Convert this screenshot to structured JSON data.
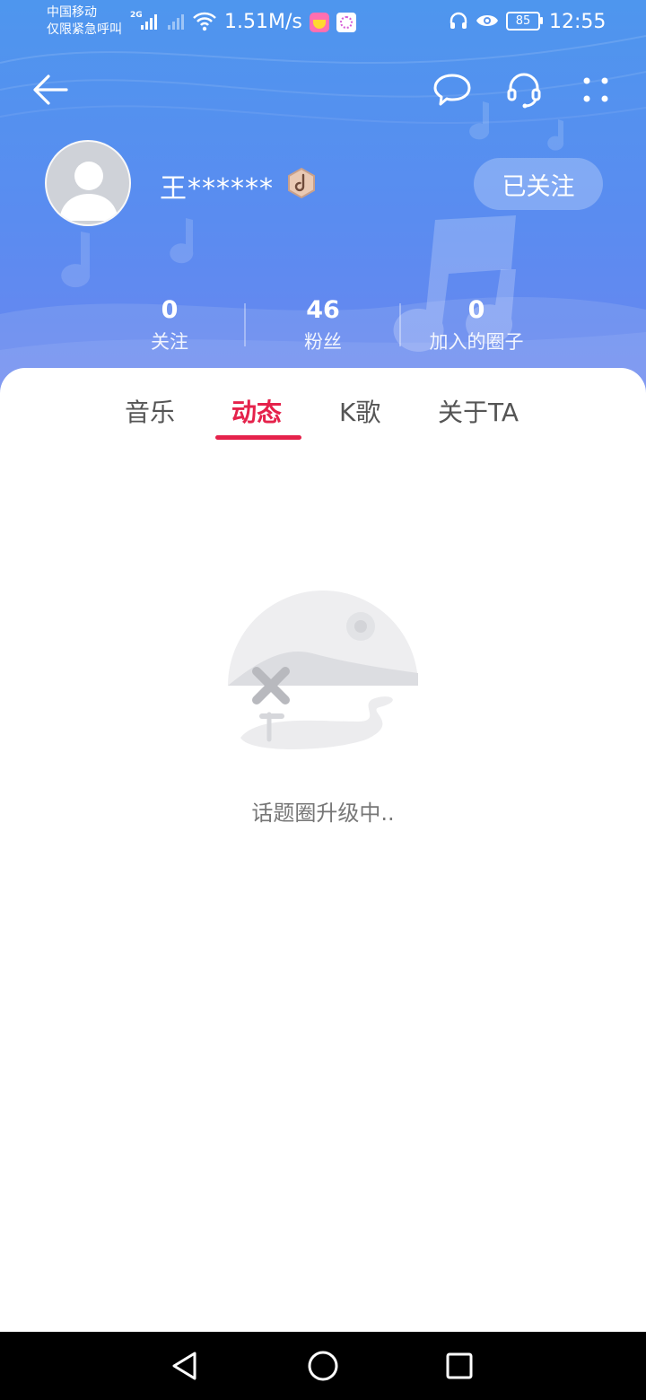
{
  "status_bar": {
    "carrier_line1": "中国移动",
    "carrier_line2": "仅限紧急呼叫",
    "network_type": "2G",
    "speed": "1.51M/s",
    "battery": "85",
    "time": "12:55",
    "icons": [
      "signal-icon",
      "signal-off-icon",
      "wifi-icon",
      "app-icon",
      "app-icon",
      "headphones-icon",
      "eye-icon",
      "battery-icon"
    ]
  },
  "nav": {
    "icons": [
      "back-arrow-icon",
      "message-icon",
      "headset-icon",
      "more-icon"
    ]
  },
  "profile": {
    "username": "王******",
    "follow_button": "已关注",
    "badge_icon": "music-level-badge-icon",
    "accent_color": "#5a8cf0"
  },
  "stats": [
    {
      "value": "0",
      "label": "关注"
    },
    {
      "value": "46",
      "label": "粉丝"
    },
    {
      "value": "0",
      "label": "加入的圈子"
    }
  ],
  "tabs": [
    {
      "label": "音乐",
      "active": false
    },
    {
      "label": "动态",
      "active": true
    },
    {
      "label": "K歌",
      "active": false
    },
    {
      "label": "关于TA",
      "active": false
    }
  ],
  "active_color": "#e5224b",
  "empty_state": {
    "text": "话题圈升级中..",
    "icon": "empty-landscape-icon"
  },
  "system_nav": [
    "back-triangle-icon",
    "home-circle-icon",
    "recents-square-icon"
  ]
}
